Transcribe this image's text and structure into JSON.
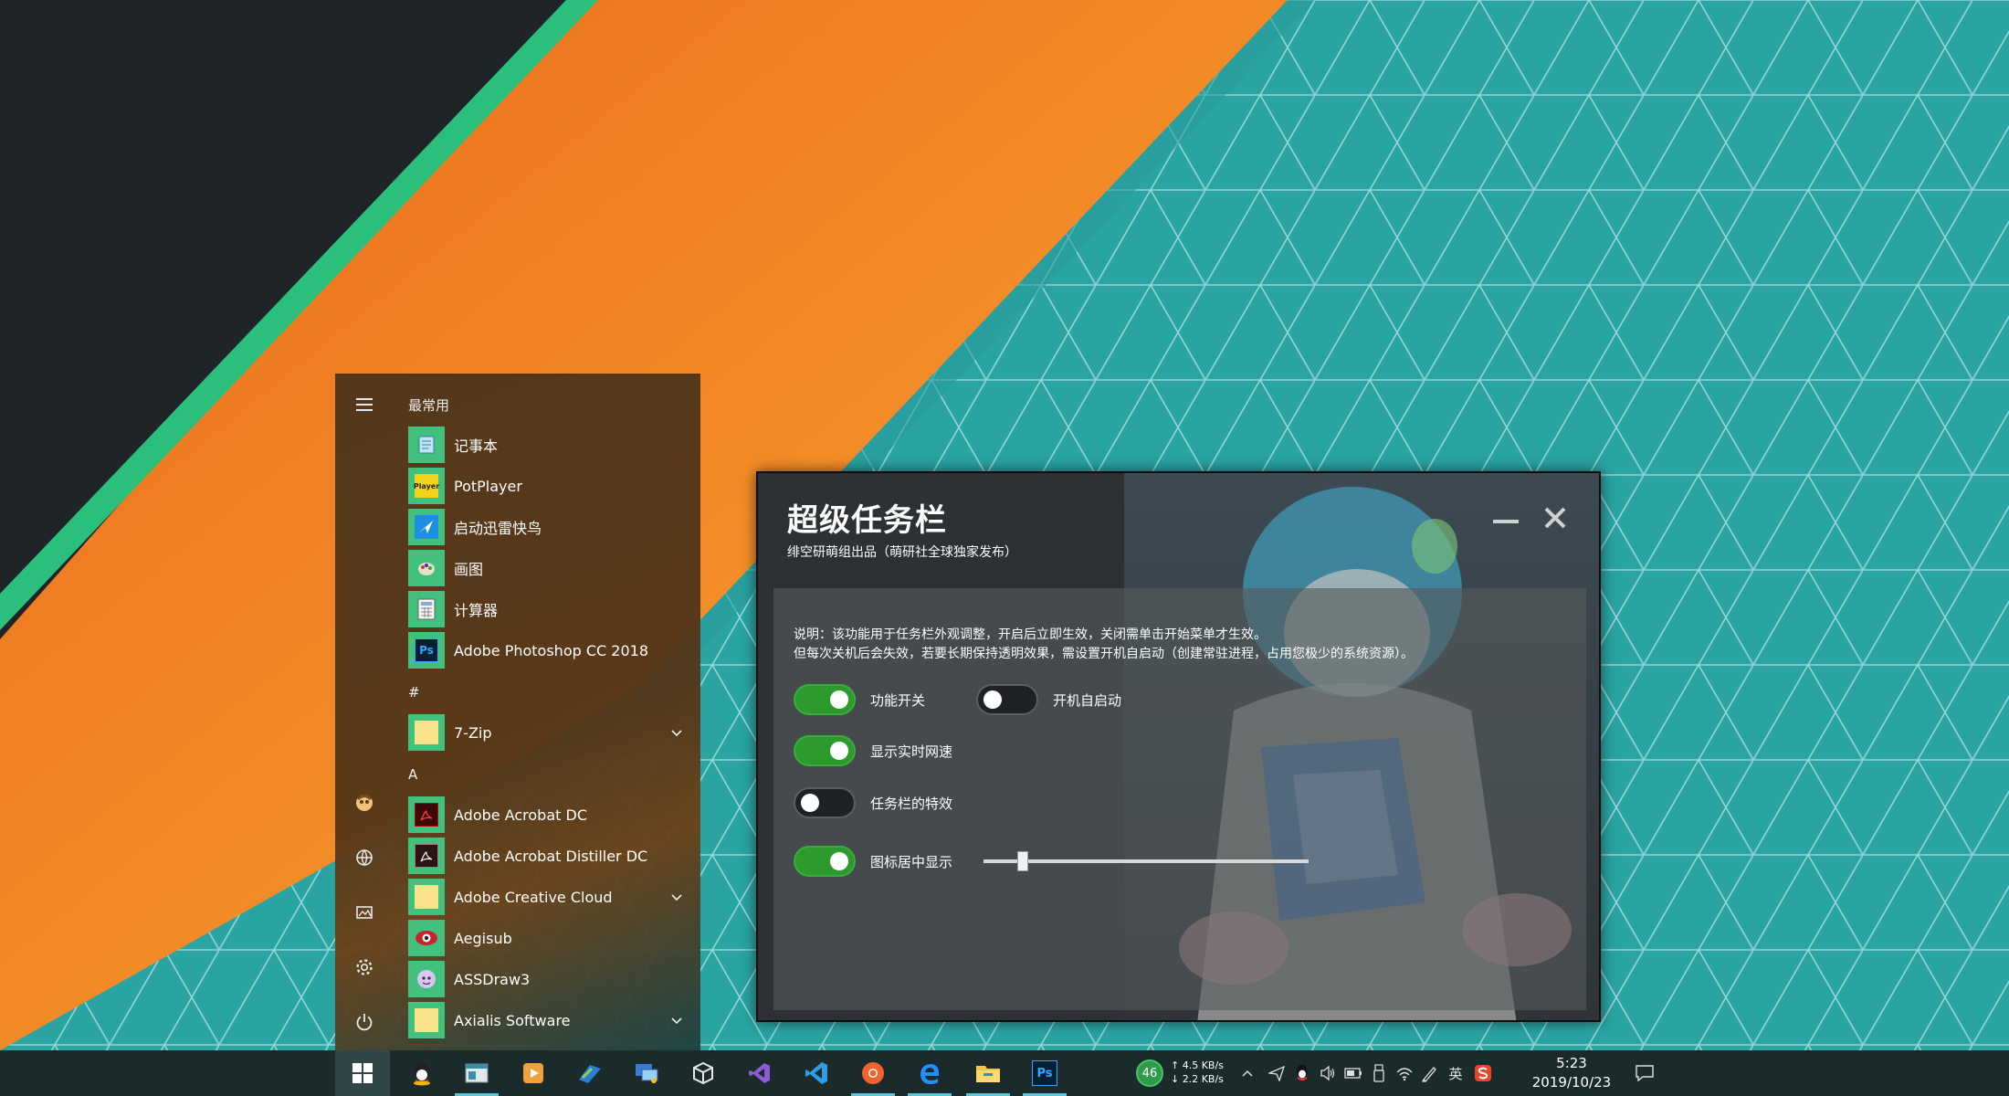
{
  "dialog": {
    "title": "超级任务栏",
    "subtitle": "绯空研萌组出品（萌研社全球独家发布）",
    "note_line1": "说明：该功能用于任务栏外观调整，开启后立即生效，关闭需单击开始菜单才生效。",
    "note_line2": "但每次关机后会失效，若要长期保持透明效果，需设置开机自启动（创建常驻进程，占用您极少的系统资源）。",
    "toggles": [
      {
        "label": "功能开关",
        "state": "on"
      },
      {
        "label": "开机自启动",
        "state": "off"
      },
      {
        "label": "显示实时网速",
        "state": "on"
      },
      {
        "label": "任务栏的特效",
        "state": "off"
      },
      {
        "label": "图标居中显示",
        "state": "on"
      }
    ],
    "slider_value": 0.12
  },
  "start_menu": {
    "section_frequent": "最常用",
    "section_hash": "#",
    "section_a": "A",
    "apps": [
      {
        "label": "记事本",
        "icon": "notepad-icon"
      },
      {
        "label": "PotPlayer",
        "icon": "potplayer-icon"
      },
      {
        "label": "启动迅雷快鸟",
        "icon": "thunder-bird-icon"
      },
      {
        "label": "画图",
        "icon": "paint-icon"
      },
      {
        "label": "计算器",
        "icon": "calculator-icon"
      },
      {
        "label": "Adobe Photoshop CC 2018",
        "icon": "photoshop-icon"
      },
      {
        "label": "7-Zip",
        "icon": "folder-icon",
        "expandable": true
      },
      {
        "label": "Adobe Acrobat DC",
        "icon": "acrobat-icon"
      },
      {
        "label": "Adobe Acrobat Distiller DC",
        "icon": "acrobat-distiller-icon"
      },
      {
        "label": "Adobe Creative Cloud",
        "icon": "folder-icon",
        "expandable": true
      },
      {
        "label": "Aegisub",
        "icon": "aegisub-icon"
      },
      {
        "label": "ASSDraw3",
        "icon": "assdraw-icon"
      },
      {
        "label": "Axialis Software",
        "icon": "folder-icon",
        "expandable": true
      }
    ]
  },
  "taskbar": {
    "pinned": [
      "qq-icon",
      "app-window-icon",
      "media-player-icon",
      "thunder-icon",
      "remote-desktop-icon",
      "virtualbox-icon",
      "visual-studio-icon",
      "vscode-icon",
      "chrome-icon",
      "edge-icon",
      "file-explorer-icon",
      "photoshop-icon"
    ],
    "net_badge": "46",
    "upload_speed": "↑ 4.5 KB/s",
    "download_speed": "↓ 2.2 KB/s",
    "ime": "英",
    "time": "5:23",
    "date": "2019/10/23"
  },
  "colors": {
    "accent_green": "#41c07e",
    "toggle_on": "#2e9a2e",
    "wallpaper_orange": "#f08a24",
    "wallpaper_teal": "#2aa3a3"
  }
}
